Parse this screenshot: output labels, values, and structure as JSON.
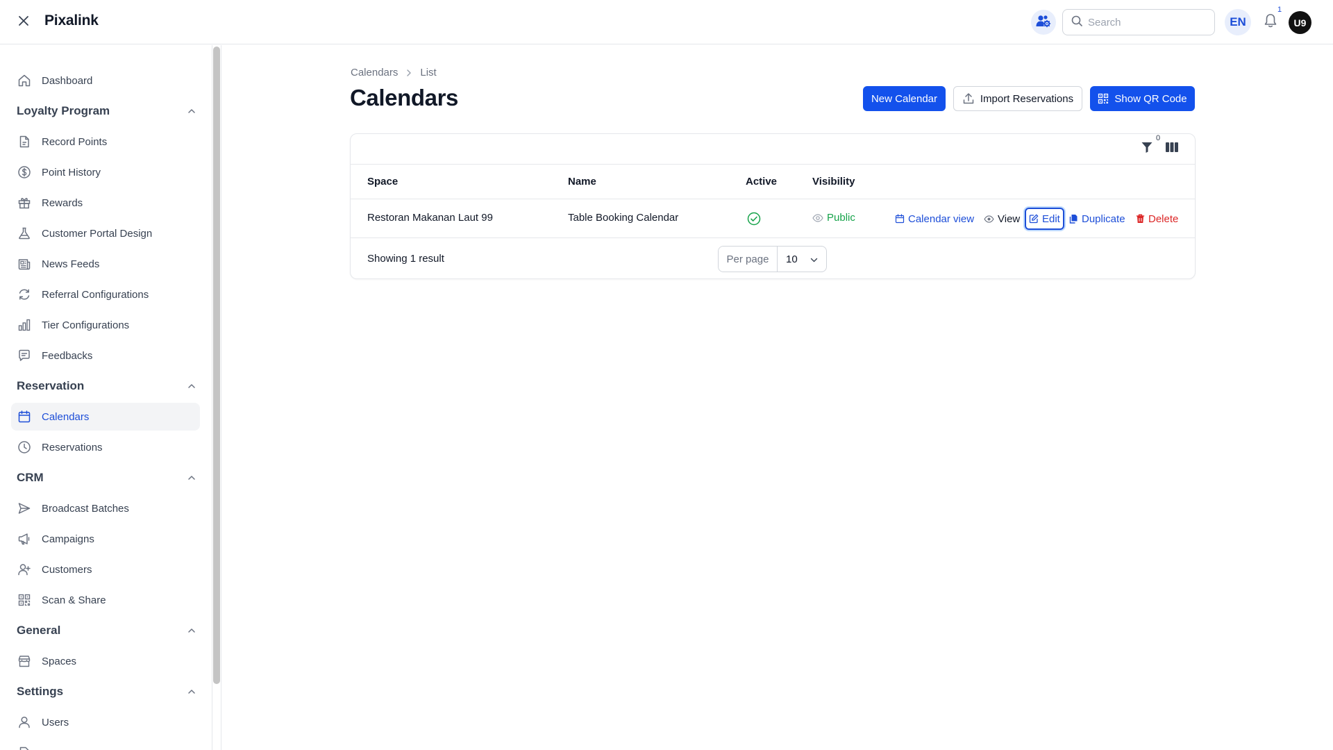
{
  "app": {
    "brand": "Pixalink"
  },
  "topbar": {
    "search_placeholder": "Search",
    "language": "EN",
    "notification_count": "1",
    "avatar_initials": "U9"
  },
  "sidebar": {
    "dashboard": "Dashboard",
    "groups": {
      "loyalty": "Loyalty Program",
      "reservation": "Reservation",
      "crm": "CRM",
      "general": "General",
      "settings": "Settings"
    },
    "items": {
      "record_points": "Record Points",
      "point_history": "Point History",
      "rewards": "Rewards",
      "customer_portal_design": "Customer Portal Design",
      "news_feeds": "News Feeds",
      "referral_configurations": "Referral Configurations",
      "tier_configurations": "Tier Configurations",
      "feedbacks": "Feedbacks",
      "calendars": "Calendars",
      "reservations": "Reservations",
      "broadcast_batches": "Broadcast Batches",
      "campaigns": "Campaigns",
      "customers": "Customers",
      "scan_share": "Scan & Share",
      "spaces": "Spaces",
      "users": "Users"
    }
  },
  "main": {
    "breadcrumb": {
      "root": "Calendars",
      "current": "List"
    },
    "title": "Calendars",
    "buttons": {
      "new_calendar": "New Calendar",
      "import_reservations": "Import Reservations",
      "show_qr_code": "Show QR Code"
    },
    "table": {
      "filter_count": "0",
      "columns": {
        "space": "Space",
        "name": "Name",
        "active": "Active",
        "visibility": "Visibility"
      },
      "rows": [
        {
          "space": "Restoran Makanan Laut 99",
          "name": "Table Booking Calendar",
          "active": true,
          "visibility": "Public",
          "actions": {
            "calendar_view": "Calendar view",
            "view": "View",
            "edit": "Edit",
            "duplicate": "Duplicate",
            "delete": "Delete"
          }
        }
      ],
      "footer": {
        "result_text": "Showing 1 result",
        "per_page_label": "Per page",
        "per_page_value": "10"
      }
    }
  },
  "colors": {
    "primary": "#1351ec",
    "link": "#1d4ed8",
    "success": "#16a34a",
    "danger": "#dc2626"
  }
}
